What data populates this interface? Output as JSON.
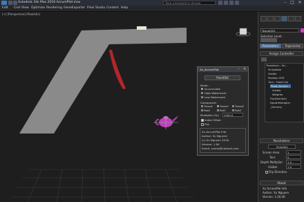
{
  "titlebar": {
    "title": "Autodesk 3ds Max 2016   AccumPlot.max",
    "search_placeholder": "Type a keyword or phrase"
  },
  "menu": [
    "Edit",
    "Civil View",
    "Optimize",
    "Rendering",
    "GeneExporter",
    "Pixel Studio",
    "Content",
    "Help"
  ],
  "viewport": {
    "label": "[+] [Perspective] [Realistic]"
  },
  "panel": {
    "object_name": "Teapot001",
    "selection_level": "Selection Level:",
    "tab_parameters": "Parameters",
    "tab_trajectories": "Trajectories",
    "assign_controller": "Assign Controller",
    "tree": [
      "Transform : Xu...",
      "Scriptable",
      "Visible",
      "Position XYZ",
      "Turn : Float List",
      "Float_Accum...",
      "Visible",
      "Weights",
      "FlipDirection",
      "DepthMultiplier",
      "_Dummy"
    ],
    "parameters_title": "Parameters",
    "pp_value": "Point001",
    "screen_area_label": "Screen Area",
    "screen_area_value": "1",
    "turn_label": "Turn",
    "turn_value": "0",
    "depth_label": "Depth Multiplier",
    "depth_value": "1.0",
    "visible_label": "Visible",
    "visible_value": "1.0",
    "flip_label": "Flip Direction",
    "about_title": "About",
    "about_lines": [
      "Xu ScreenMe Info",
      "Author: Xu Nguyen",
      "Version: 1.00.00"
    ]
  },
  "dialog": {
    "title": "Xu_AccumPlot",
    "point_name": "Point004",
    "mode_label": "Mode:",
    "modes": [
      "Accumulate",
      "High Watermark",
      "Low Watermark"
    ],
    "component_label": "Component:",
    "components": [
      "TransX",
      "TransY",
      "TransZ",
      "RotX",
      "RotY",
      "RotZ"
    ],
    "multiplier_label": "Multiplier (%):",
    "multiplier_value": "1000.0",
    "initial_offset": "Initial Offset",
    "flip": "Flip",
    "info": [
      "Xu AccumPlot Info",
      "Author: Xu Nguyen",
      "(c) Xu Nguyen 2016",
      "Version: 1.00",
      "Email: xuena@hotmail.com"
    ]
  }
}
